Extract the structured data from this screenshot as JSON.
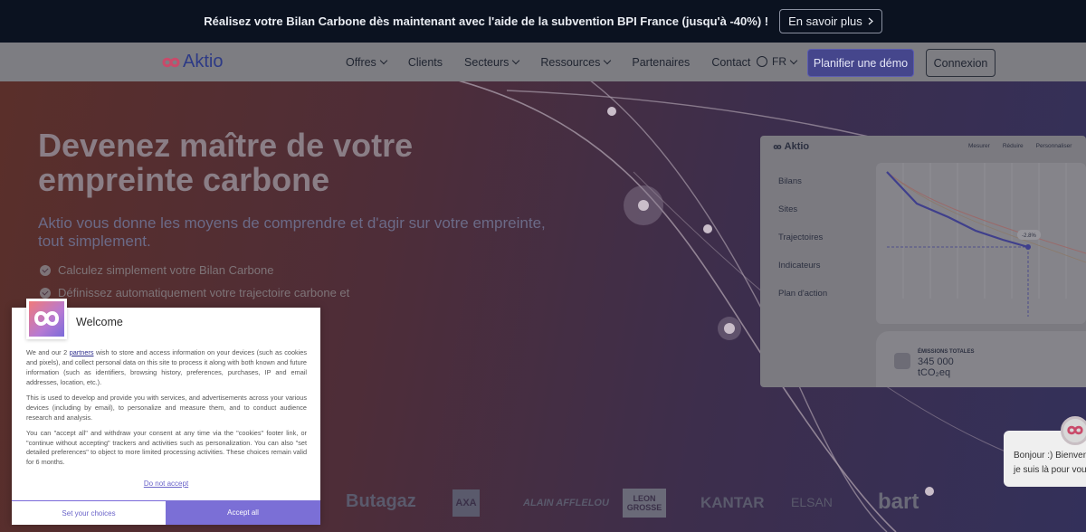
{
  "banner": {
    "text": "Réalisez votre Bilan Carbone dès maintenant avec l'aide de la subvention BPI France (jusqu'à -40%) !",
    "cta": "En savoir plus",
    "cta_icon": "chevron-right-icon"
  },
  "header": {
    "logo_text": "Aktio",
    "nav": [
      {
        "label": "Offres",
        "has_dropdown": true
      },
      {
        "label": "Clients",
        "has_dropdown": false
      },
      {
        "label": "Secteurs",
        "has_dropdown": true
      },
      {
        "label": "Ressources",
        "has_dropdown": true
      },
      {
        "label": "Partenaires",
        "has_dropdown": false
      },
      {
        "label": "Contact",
        "has_dropdown": false
      }
    ],
    "language": "FR",
    "demo_button": "Planifier une démo",
    "login_button": "Connexion",
    "accent_color": "#5b5cb0"
  },
  "hero": {
    "title": "Devenez maître de votre empreinte carbone",
    "subtitle": "Aktio vous donne les moyens de comprendre et d'agir sur votre empreinte, tout simplement.",
    "features": [
      "Calculez simplement votre Bilan Carbone",
      "Définissez automatiquement votre trajectoire carbone et"
    ]
  },
  "dashboard": {
    "logo": "Aktio",
    "tabs": [
      "Mesurer",
      "Réduire",
      "Personnaliser"
    ],
    "menu": [
      "Bilans",
      "Sites",
      "Trajectoires",
      "Indicateurs",
      "Plan d'action"
    ],
    "chart_badge": "-2.8%",
    "stat_label": "ÉMISSIONS TOTALES",
    "stat_value": "345 000",
    "stat_unit": "tCO₂eq"
  },
  "client_logos": [
    "Butagaz",
    "AXA",
    "ALAIN AFFLELOU",
    "LEON GROSSE",
    "KANTAR",
    "ELSAN",
    "bart"
  ],
  "chat": {
    "line1": "Bonjour :) Bienvenue",
    "line2": "je suis là pour vous"
  },
  "consent": {
    "title": "Welcome",
    "p1_before": "We and our 2 ",
    "p1_link": "partners",
    "p1_after": " wish to store and access information on your devices (such as cookies and pixels), and collect personal data on this site to process it along with both known and future information (such as identifiers, browsing history, preferences, purchases, IP and email addresses, location, etc.).",
    "p2": "This is used to develop and provide you with services, and advertisements across your various devices (including by email), to personalize and measure them, and to conduct audience research and analysis.",
    "p3": "You can \"accept all\" and withdraw your consent at any time via the \"cookies\" footer link, or \"continue without accepting\" trackers and activities such as personalization. You can also \"set detailed preferences\" to object to more limited processing activities. These choices remain valid for 6 months.",
    "reject": "Do not accept",
    "choices_button": "Set your choices",
    "accept_button": "Accept all",
    "accent_color": "#7b6fd6"
  }
}
